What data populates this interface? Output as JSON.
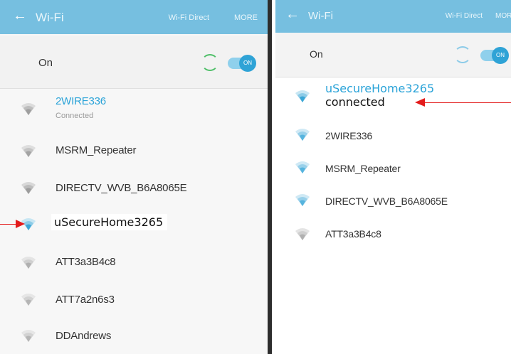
{
  "left": {
    "appbar": {
      "title": "Wi-Fi",
      "direct": "Wi-Fi Direct",
      "more": "MORE"
    },
    "onbar": {
      "label": "On",
      "toggle_text": "ON"
    },
    "networks": [
      {
        "name": "2WIRE336",
        "status": "Connected"
      },
      {
        "name": "MSRM_Repeater"
      },
      {
        "name": "DIRECTV_WVB_B6A8065E"
      },
      {
        "name": "uSecureHome3265"
      },
      {
        "name": "ATT3a3B4c8"
      },
      {
        "name": "ATT7a2n6s3"
      },
      {
        "name": "DDAndrews"
      }
    ]
  },
  "right": {
    "appbar": {
      "title": "Wi-Fi",
      "direct": "Wi-Fi Direct",
      "more": "MORE"
    },
    "onbar": {
      "label": "On",
      "toggle_text": "ON"
    },
    "networks": [
      {
        "name": "uSecureHome3265",
        "status": "connected"
      },
      {
        "name": "2WIRE336"
      },
      {
        "name": "MSRM_Repeater"
      },
      {
        "name": "DIRECTV_WVB_B6A8065E"
      },
      {
        "name": "ATT3a3B4c8"
      }
    ]
  },
  "colors": {
    "appbar": "#76bfe0",
    "accent": "#2aa3d8",
    "arrow": "#e31b1b",
    "divider": "#2d2d2d"
  }
}
